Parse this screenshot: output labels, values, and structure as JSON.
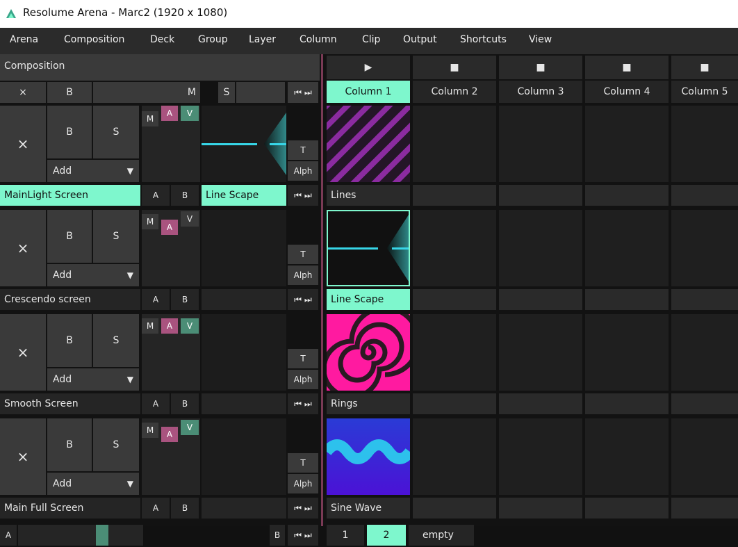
{
  "window": {
    "title": "Resolume Arena - Marc2 (1920 x 1080)"
  },
  "menu": [
    "Arena",
    "Composition",
    "Deck",
    "Group",
    "Layer",
    "Column",
    "Clip",
    "Output",
    "Shortcuts",
    "View"
  ],
  "composition": {
    "label": "Composition",
    "x": "×",
    "b": "B",
    "m": "M",
    "s": "S",
    "nav": "⏮ ⏭"
  },
  "columns": [
    {
      "label": "Column 1",
      "active": true,
      "play": "▶"
    },
    {
      "label": "Column 2",
      "active": false,
      "play": "■"
    },
    {
      "label": "Column 3",
      "active": false,
      "play": "■"
    },
    {
      "label": "Column 4",
      "active": false,
      "play": "■"
    },
    {
      "label": "Column 5",
      "active": false,
      "play": "■"
    }
  ],
  "layer_controls": {
    "x": "×",
    "b": "B",
    "s": "S",
    "add": "Add",
    "caret": "▼",
    "m": "M",
    "a": "A",
    "v": "V",
    "t": "T",
    "alph": "Alph",
    "ab_a": "A",
    "ab_b": "B",
    "nav": "⏮ ⏭"
  },
  "layers": [
    {
      "name": "MainLight Screen",
      "active": true,
      "clip_name": "Line Scape",
      "clips": [
        {
          "label": "Lines",
          "thumb": "lines"
        }
      ]
    },
    {
      "name": "Crescendo screen",
      "active": false,
      "clip_name": "",
      "clips": [
        {
          "label": "Line Scape",
          "thumb": "linescape",
          "selected": true
        }
      ]
    },
    {
      "name": "Smooth Screen",
      "active": false,
      "clip_name": "",
      "clips": [
        {
          "label": "Rings",
          "thumb": "rings"
        }
      ]
    },
    {
      "name": "Main Full Screen",
      "active": false,
      "clip_name": "",
      "clips": [
        {
          "label": "Sine Wave",
          "thumb": "sine"
        }
      ]
    }
  ],
  "bottom": {
    "a": "A",
    "b": "B",
    "nav": "⏮ ⏭",
    "decks": [
      {
        "label": "1",
        "active": false
      },
      {
        "label": "2",
        "active": true
      },
      {
        "label": "empty",
        "active": false
      }
    ]
  },
  "colors": {
    "accent": "#7ef7cd",
    "a_pink": "#a9537f",
    "v_green": "#4b8d76",
    "divider": "#7a3a55"
  }
}
